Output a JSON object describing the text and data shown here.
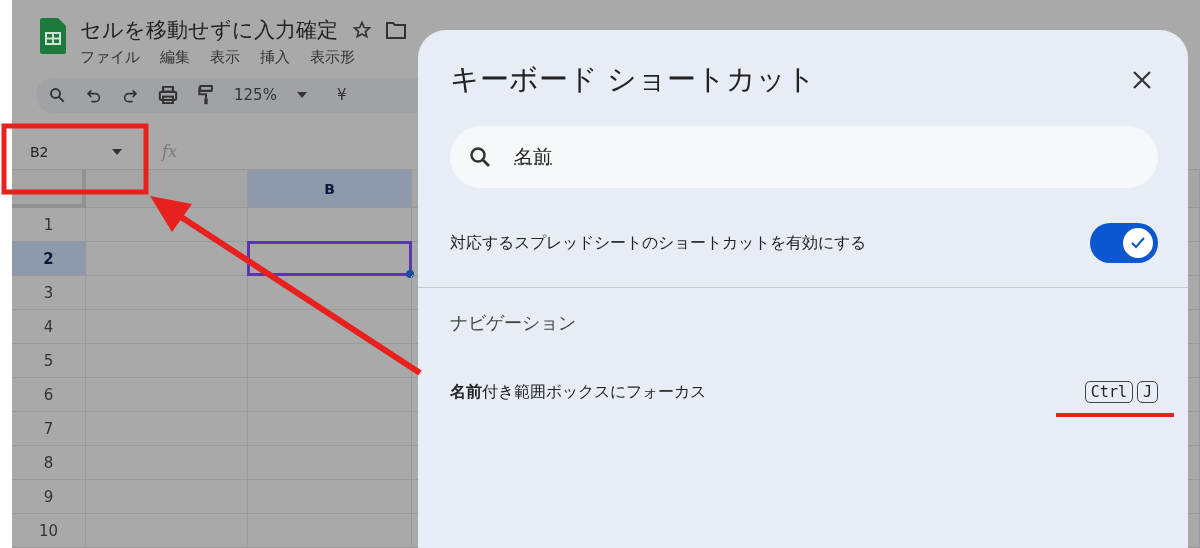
{
  "document": {
    "title": "セルを移動せずに入力確定"
  },
  "menus": [
    "ファイル",
    "編集",
    "表示",
    "挿入",
    "表示形"
  ],
  "toolbar": {
    "zoom": "125%",
    "currency": "¥"
  },
  "name_box": {
    "value": "B2"
  },
  "formula_bar": {
    "label": "fx"
  },
  "grid": {
    "columns": [
      {
        "label": "B",
        "selected": true
      }
    ],
    "rows": [
      {
        "label": "1",
        "selected": false
      },
      {
        "label": "2",
        "selected": true
      },
      {
        "label": "3",
        "selected": false
      },
      {
        "label": "4",
        "selected": false
      },
      {
        "label": "5",
        "selected": false
      },
      {
        "label": "6",
        "selected": false
      },
      {
        "label": "7",
        "selected": false
      },
      {
        "label": "8",
        "selected": false
      },
      {
        "label": "9",
        "selected": false
      },
      {
        "label": "10",
        "selected": false
      }
    ]
  },
  "dialog": {
    "title": "キーボード ショートカット",
    "search": {
      "value": "名前"
    },
    "toggle": {
      "label": "対応するスプレッドシートのショートカットを有効にする",
      "on": true
    },
    "section": "ナビゲーション",
    "shortcuts": [
      {
        "description": "**名前**付き範囲ボックスにフォーカス",
        "keys": [
          "Ctrl",
          "J"
        ]
      }
    ]
  }
}
